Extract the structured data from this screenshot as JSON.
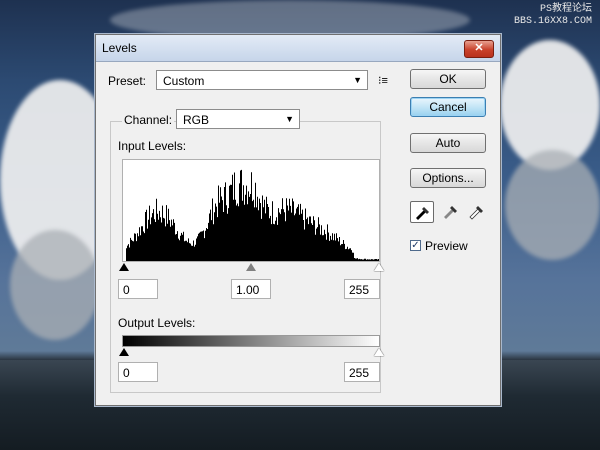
{
  "watermark": {
    "line1": "PS教程论坛",
    "line2": "BBS.16XX8.COM"
  },
  "dialog": {
    "title": "Levels",
    "close_glyph": "✕",
    "preset": {
      "label": "Preset:",
      "value": "Custom"
    },
    "channel": {
      "label": "Channel:",
      "value": "RGB"
    },
    "input_levels": {
      "label": "Input Levels:",
      "black": "0",
      "gamma": "1.00",
      "white": "255"
    },
    "output_levels": {
      "label": "Output Levels:",
      "black": "0",
      "white": "255"
    },
    "buttons": {
      "ok": "OK",
      "cancel": "Cancel",
      "auto": "Auto",
      "options": "Options..."
    },
    "preview": {
      "label": "Preview",
      "checked": true,
      "check_glyph": "✓"
    },
    "menu_glyph": "⁝≡",
    "combo_arrow": "▼"
  },
  "icons": {
    "black_eyedropper": "black-eyedropper-icon",
    "gray_eyedropper": "gray-eyedropper-icon",
    "white_eyedropper": "white-eyedropper-icon"
  }
}
